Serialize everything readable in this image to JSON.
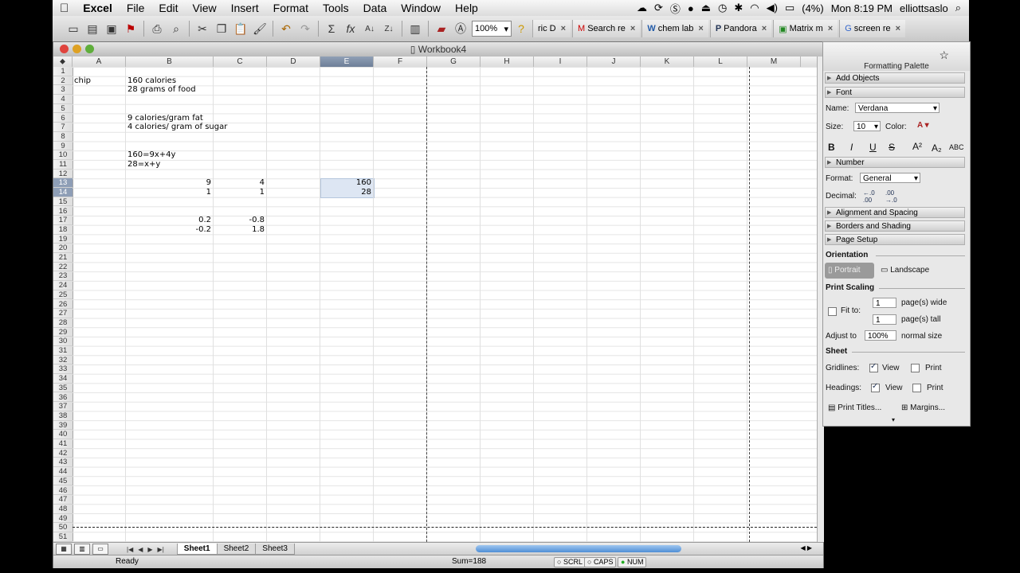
{
  "menubar": {
    "app": "Excel",
    "items": [
      "File",
      "Edit",
      "View",
      "Insert",
      "Format",
      "Tools",
      "Data",
      "Window",
      "Help"
    ],
    "battery": "(4%)",
    "clock": "Mon 8:19 PM",
    "user": "elliottsaslo"
  },
  "toolbar": {
    "zoom": "100%",
    "browser_tabs": [
      "ric D",
      "Search re",
      "chem lab",
      "Pandora",
      "Matrix m",
      "screen re"
    ]
  },
  "window": {
    "title": "Workbook4"
  },
  "columns": [
    "A",
    "B",
    "C",
    "D",
    "E",
    "F",
    "G",
    "H",
    "I",
    "J",
    "K",
    "L",
    "M"
  ],
  "rows_count": 51,
  "cells": [
    {
      "ref": "A2",
      "value": "chip",
      "align": "left"
    },
    {
      "ref": "B2",
      "value": "160 calories",
      "align": "left"
    },
    {
      "ref": "B3",
      "value": "28 grams of food",
      "align": "left"
    },
    {
      "ref": "B6",
      "value": "9 calories/gram fat",
      "align": "left"
    },
    {
      "ref": "B7",
      "value": "4 calories/ gram of sugar",
      "align": "left"
    },
    {
      "ref": "B10",
      "value": "160=9x+4y",
      "align": "left"
    },
    {
      "ref": "B11",
      "value": "28=x+y",
      "align": "left"
    },
    {
      "ref": "B13",
      "value": "9",
      "align": "right"
    },
    {
      "ref": "C13",
      "value": "4",
      "align": "right"
    },
    {
      "ref": "E13",
      "value": "160",
      "align": "right"
    },
    {
      "ref": "B14",
      "value": "1",
      "align": "right"
    },
    {
      "ref": "C14",
      "value": "1",
      "align": "right"
    },
    {
      "ref": "E14",
      "value": "28",
      "align": "right"
    },
    {
      "ref": "B17",
      "value": "0.2",
      "align": "right"
    },
    {
      "ref": "C17",
      "value": "-0.8",
      "align": "right"
    },
    {
      "ref": "B18",
      "value": "-0.2",
      "align": "right"
    },
    {
      "ref": "C18",
      "value": "1.8",
      "align": "right"
    }
  ],
  "selection": {
    "col": "E",
    "rows": [
      13,
      14
    ]
  },
  "sheets": [
    "Sheet1",
    "Sheet2",
    "Sheet3"
  ],
  "active_sheet": "Sheet1",
  "status": {
    "mode": "Ready",
    "sum": "Sum=188",
    "scrl": "SCRL",
    "caps": "CAPS",
    "num": "NUM"
  },
  "palette": {
    "title": "Formatting Palette",
    "sections": {
      "add_objects": "Add Objects",
      "font": "Font",
      "number": "Number",
      "alignment": "Alignment and Spacing",
      "borders": "Borders and Shading",
      "page_setup": "Page Setup"
    },
    "font": {
      "name_label": "Name:",
      "name": "Verdana",
      "size_label": "Size:",
      "size": "10",
      "color_label": "Color:"
    },
    "number": {
      "format_label": "Format:",
      "format": "General",
      "decimal_label": "Decimal:"
    },
    "orientation": {
      "label": "Orientation",
      "portrait": "Portrait",
      "landscape": "Landscape"
    },
    "scaling": {
      "label": "Print Scaling",
      "fit_to": "Fit to:",
      "wide_value": "1",
      "wide": "page(s) wide",
      "tall_value": "1",
      "tall": "page(s) tall",
      "adjust": "Adjust to",
      "adjust_value": "100%",
      "normal": "normal size"
    },
    "sheet": {
      "label": "Sheet",
      "gridlines": "Gridlines:",
      "headings": "Headings:",
      "view": "View",
      "print": "Print",
      "print_titles": "Print Titles...",
      "margins": "Margins..."
    }
  }
}
